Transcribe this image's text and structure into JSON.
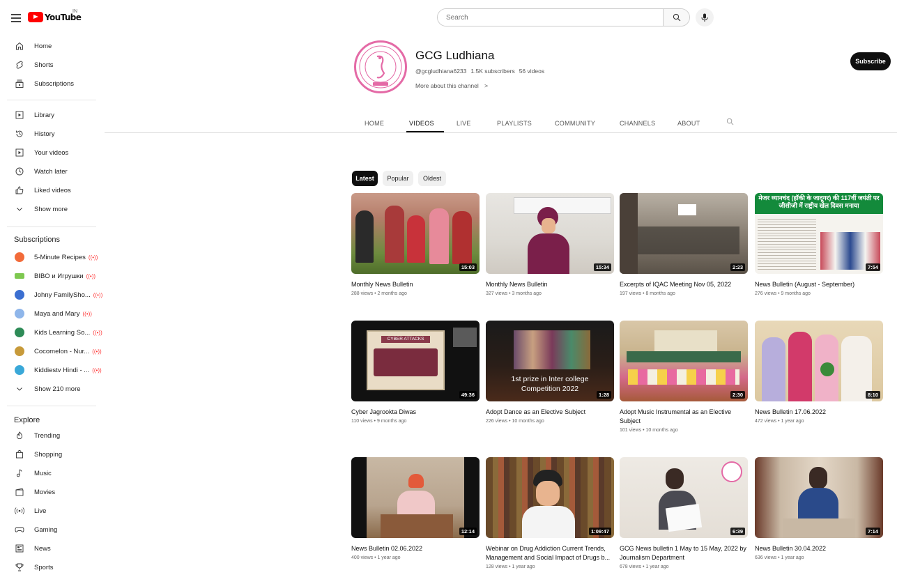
{
  "topbar": {
    "logo_text": "YouTube",
    "country_code": "IN",
    "search_placeholder": "Search"
  },
  "sidebar": {
    "main": [
      {
        "label": "Home",
        "icon": "home-icon"
      },
      {
        "label": "Shorts",
        "icon": "shorts-icon"
      },
      {
        "label": "Subscriptions",
        "icon": "subscriptions-icon"
      }
    ],
    "library": [
      {
        "label": "Library",
        "icon": "library-icon"
      },
      {
        "label": "History",
        "icon": "history-icon"
      },
      {
        "label": "Your videos",
        "icon": "your-videos-icon"
      },
      {
        "label": "Watch later",
        "icon": "watch-later-icon"
      },
      {
        "label": "Liked videos",
        "icon": "liked-videos-icon"
      },
      {
        "label": "Show more",
        "icon": "chevron-down-icon"
      }
    ],
    "subscriptions_heading": "Subscriptions",
    "subscriptions": [
      {
        "label": "5-Minute Recipes",
        "color": "#f26b3a"
      },
      {
        "label": "BIBO и Игрушки",
        "color": "#7ec850"
      },
      {
        "label": "Johny FamilySho...",
        "color": "#3b6fd1"
      },
      {
        "label": "Maya and Mary",
        "color": "#8fb6ea"
      },
      {
        "label": "Kids Learning So...",
        "color": "#2e8b57"
      },
      {
        "label": "Cocomelon - Nur...",
        "color": "#c79a3a"
      },
      {
        "label": "Kiddiestv Hindi - ...",
        "color": "#3aa8d8"
      }
    ],
    "show_more_subs": "Show 210 more",
    "explore_heading": "Explore",
    "explore": [
      {
        "label": "Trending",
        "icon": "trending-icon"
      },
      {
        "label": "Shopping",
        "icon": "shopping-icon"
      },
      {
        "label": "Music",
        "icon": "music-icon"
      },
      {
        "label": "Movies",
        "icon": "movies-icon"
      },
      {
        "label": "Live",
        "icon": "live-icon"
      },
      {
        "label": "Gaming",
        "icon": "gaming-icon"
      },
      {
        "label": "News",
        "icon": "news-icon"
      },
      {
        "label": "Sports",
        "icon": "sports-icon"
      }
    ]
  },
  "channel": {
    "name": "GCG Ludhiana",
    "handle": "@gcgludhiana6233",
    "subscribers": "1.5K subscribers",
    "videos_count": "56 videos",
    "more_about": "More about this channel",
    "subscribe_label": "Subscribe",
    "tabs": [
      "HOME",
      "VIDEOS",
      "LIVE",
      "PLAYLISTS",
      "COMMUNITY",
      "CHANNELS",
      "ABOUT"
    ],
    "active_tab": "VIDEOS"
  },
  "filters": [
    "Latest",
    "Popular",
    "Oldest"
  ],
  "videos": [
    {
      "title": "Monthly News Bulletin",
      "meta": "288 views • 2 months ago",
      "duration": "15:03"
    },
    {
      "title": "Monthly News Bulletin",
      "meta": "327 views • 3 months ago",
      "duration": "15:34"
    },
    {
      "title": "Excerpts of IQAC Meeting Nov 05, 2022",
      "meta": "197 views • 8 months ago",
      "duration": "2:23"
    },
    {
      "title": "News Bulletin (August - September)",
      "meta": "276 views • 9 months ago",
      "duration": "7:54"
    },
    {
      "title": "Cyber Jagrookta Diwas",
      "meta": "110 views • 9 months ago",
      "duration": "49:36"
    },
    {
      "title": "Adopt Dance as an Elective Subject",
      "meta": "226 views • 10 months ago",
      "duration": "1:28"
    },
    {
      "title": "Adopt Music Instrumental as an Elective Subject",
      "meta": "101 views • 10 months ago",
      "duration": "2:30"
    },
    {
      "title": "News Bulletin 17.06.2022",
      "meta": "472 views • 1 year ago",
      "duration": "8:10"
    },
    {
      "title": "News Bulletin 02.06.2022",
      "meta": "400 views • 1 year ago",
      "duration": "12:14"
    },
    {
      "title": "Webinar on Drug Addiction Current Trends, Management and Social Impact of Drugs b...",
      "meta": "128 views • 1 year ago",
      "duration": "1:09:47"
    },
    {
      "title": "GCG News bulletin 1 May to 15 May, 2022 by Journalism Department",
      "meta": "678 views • 1 year ago",
      "duration": "6:39"
    },
    {
      "title": "News Bulletin 30.04.2022",
      "meta": "636 views • 1 year ago",
      "duration": "7:14"
    }
  ],
  "thumb_text": {
    "cyber_title": "CYBER ATTACKS",
    "dance_caption": "1st prize in Inter college Competition  2022",
    "hindi_headline": "मेजर ध्यानचंद (हॉकी के जादूगर) की 117वीं जयंती पर जीसीजी में राष्ट्रीय खेल दिवस मनाया"
  }
}
